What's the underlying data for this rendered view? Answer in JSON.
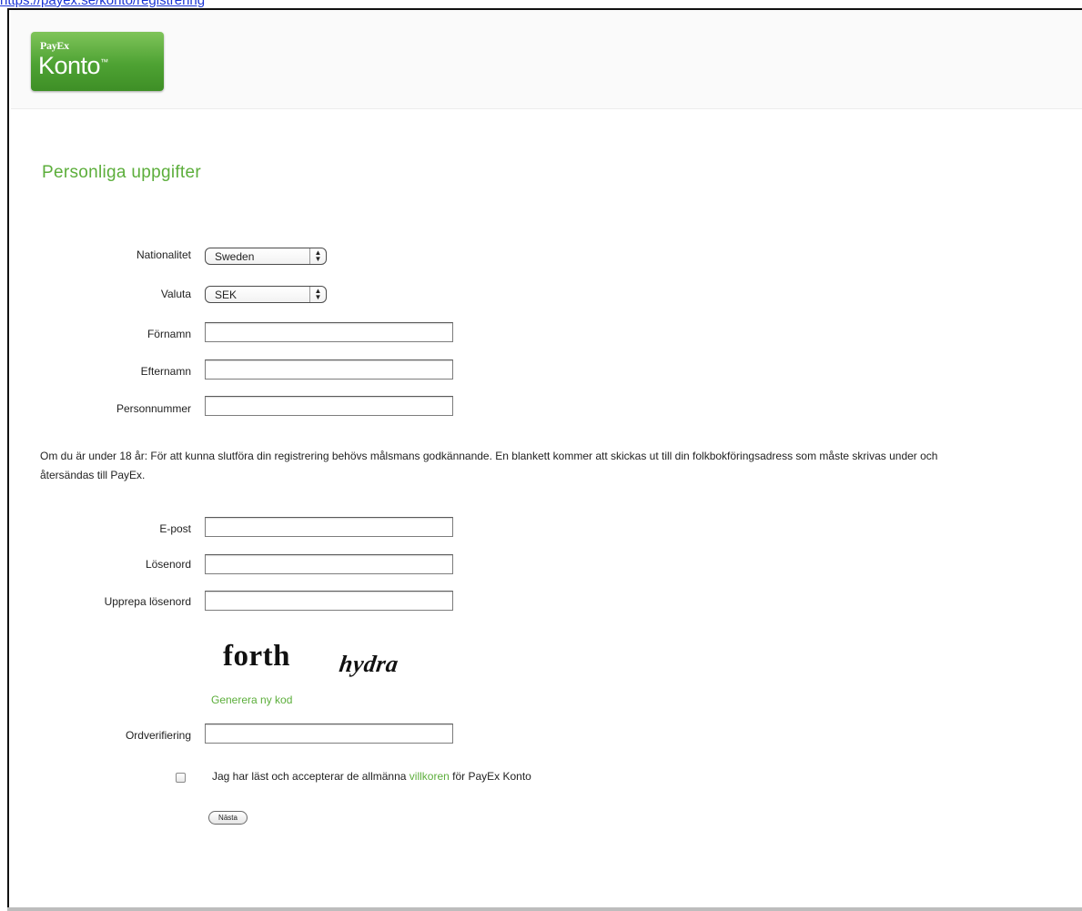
{
  "top_link": "https://payex.se/konto/registrering",
  "logo": {
    "small_text": "PayEx",
    "big_text": "Konto",
    "trademark": "™"
  },
  "page_title": "Personliga uppgifter",
  "fields": {
    "nationality": {
      "label": "Nationalitet",
      "value": "Sweden"
    },
    "currency": {
      "label": "Valuta",
      "value": "SEK"
    },
    "first_name": {
      "label": "Förnamn"
    },
    "last_name": {
      "label": "Efternamn"
    },
    "personal_number": {
      "label": "Personnummer"
    },
    "email": {
      "label": "E-post"
    },
    "password": {
      "label": "Lösenord"
    },
    "repeat_password": {
      "label": "Upprepa lösenord"
    },
    "word_verification": {
      "label": "Ordverifiering"
    }
  },
  "info_text": "Om du är under 18 år: För att kunna slutföra din registrering behövs målsmans godkännande. En blankett kommer att skickas ut till din folkbokföringsadress som måste skrivas under och återsändas till PayEx.",
  "captcha": {
    "word1": "forth",
    "word2": "hydra",
    "regenerate_label": "Generera ny kod"
  },
  "terms": {
    "before": "Jag har läst och accepterar de allmänna ",
    "link": "villkoren",
    "after": " för PayEx Konto",
    "checked": false
  },
  "next_button": "Nästa",
  "colors": {
    "accent_green": "#5cae3b",
    "link_blue": "#1a34d6"
  }
}
